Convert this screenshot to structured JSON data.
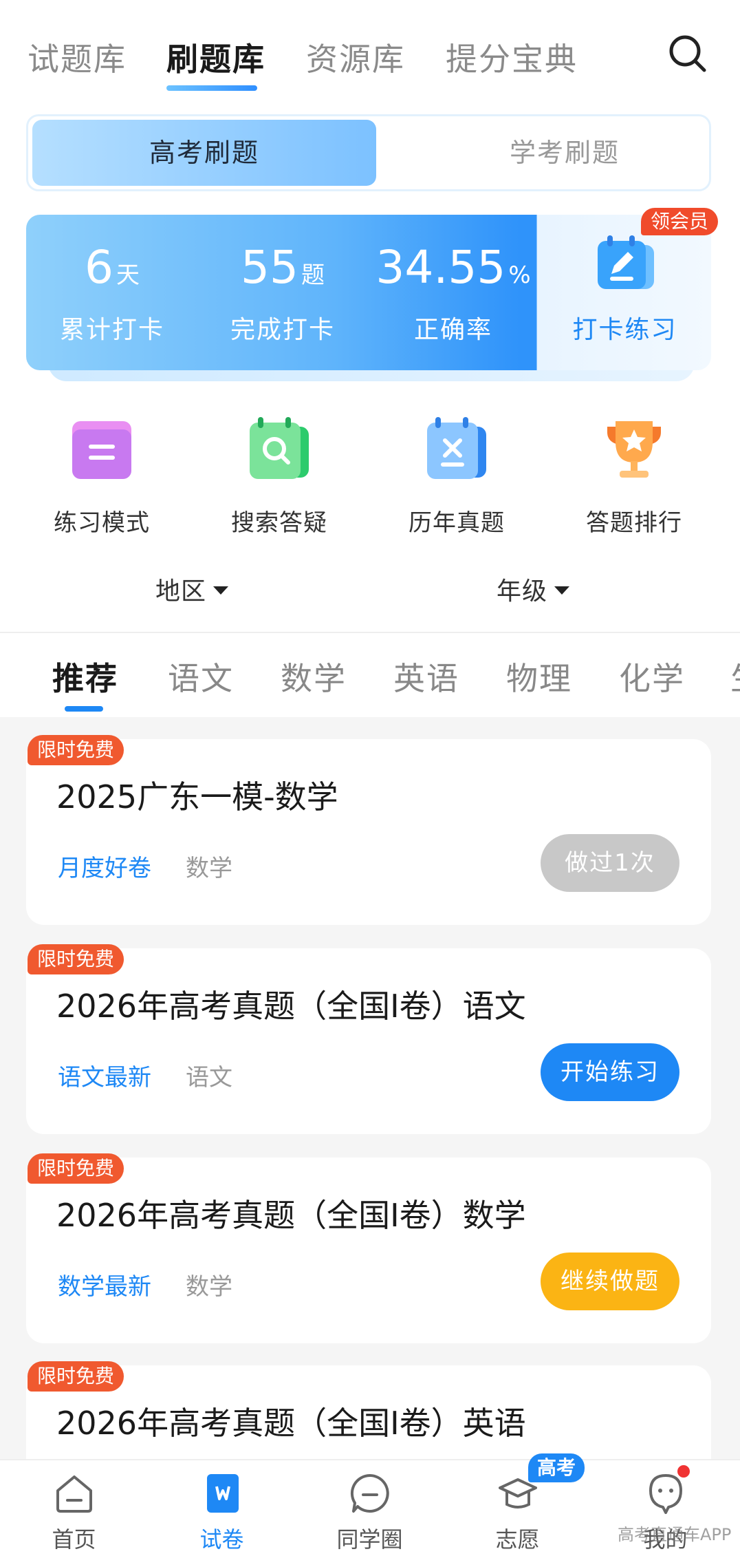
{
  "top_tabs": [
    {
      "label": "试题库"
    },
    {
      "label": "刷题库"
    },
    {
      "label": "资源库"
    },
    {
      "label": "提分宝典"
    }
  ],
  "segment": {
    "active": "高考刷题",
    "inactive": "学考刷题"
  },
  "stats": {
    "days": {
      "value": "6",
      "unit": "天",
      "label": "累计打卡"
    },
    "questions": {
      "value": "55",
      "unit": "题",
      "label": "完成打卡"
    },
    "accuracy": {
      "value": "34.55",
      "unit": "%",
      "label": "正确率"
    },
    "checkin_label": "打卡练习",
    "member_badge": "领会员"
  },
  "quick_actions": [
    {
      "label": "练习模式",
      "icon": "folder-icon"
    },
    {
      "label": "搜索答疑",
      "icon": "search-doc-icon"
    },
    {
      "label": "历年真题",
      "icon": "exam-paper-icon"
    },
    {
      "label": "答题排行",
      "icon": "trophy-icon"
    }
  ],
  "filters": {
    "region": "地区",
    "grade": "年级"
  },
  "subjects": [
    "推荐",
    "语文",
    "数学",
    "英语",
    "物理",
    "化学",
    "生"
  ],
  "cards": [
    {
      "tag": "限时免费",
      "title": "2025广东一模-数学",
      "category": "月度好卷",
      "subject": "数学",
      "button": "做过1次",
      "button_color": "#c8c8c8"
    },
    {
      "tag": "限时免费",
      "title": "2026年高考真题（全国I卷）语文",
      "category": "语文最新",
      "subject": "语文",
      "button": "开始练习",
      "button_color": "#1e88f5"
    },
    {
      "tag": "限时免费",
      "title": "2026年高考真题（全国I卷）数学",
      "category": "数学最新",
      "subject": "数学",
      "button": "继续做题",
      "button_color": "#fbb414"
    },
    {
      "tag": "限时免费",
      "title": "2026年高考真题（全国I卷）英语"
    }
  ],
  "bottom_nav": [
    {
      "label": "首页",
      "icon": "home-icon"
    },
    {
      "label": "试卷",
      "icon": "paper-icon"
    },
    {
      "label": "同学圈",
      "icon": "chat-icon"
    },
    {
      "label": "志愿",
      "icon": "graduation-cap-icon"
    },
    {
      "label": "我的",
      "icon": "profile-icon"
    }
  ],
  "gaokao_badge": "高考",
  "watermark": "高考直通车APP",
  "colors": {
    "accent": "#1e88f5",
    "free_tag": "#f0592f",
    "continue": "#fbb414"
  }
}
